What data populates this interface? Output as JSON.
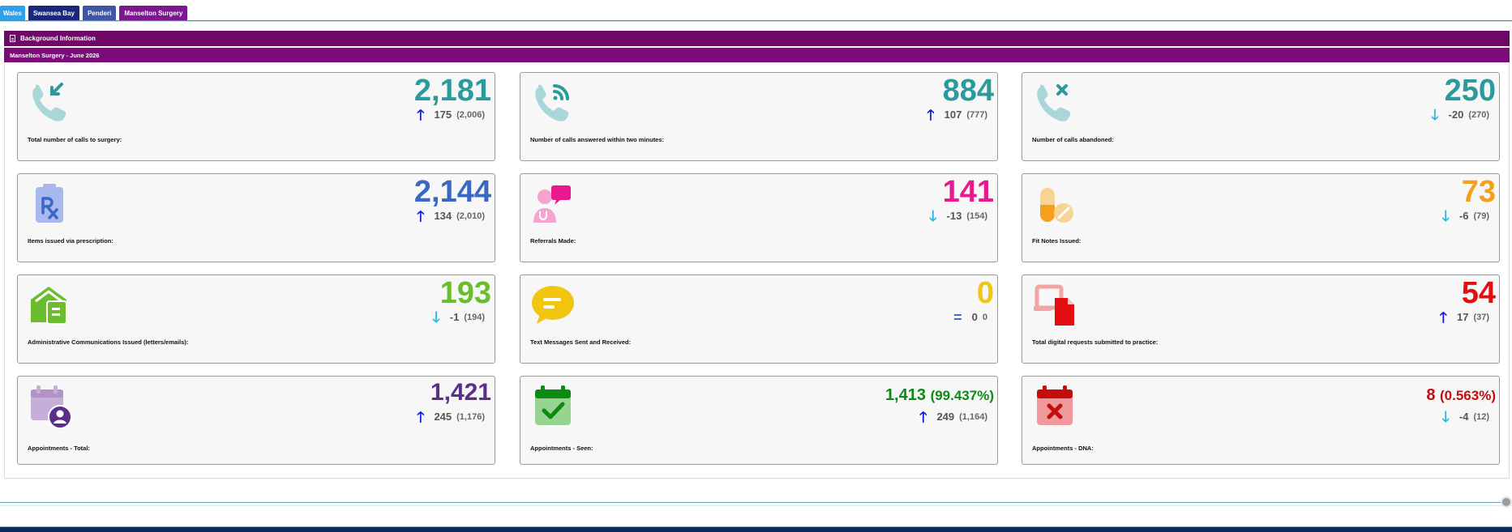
{
  "tabs": [
    {
      "label": "Wales"
    },
    {
      "label": "Swansea Bay"
    },
    {
      "label": "Penderi"
    },
    {
      "label": "Manselton Surgery"
    }
  ],
  "background_bar": {
    "label": "Background Information"
  },
  "title_bar": {
    "label": "Manselton Surgery - June 2026"
  },
  "colors": {
    "teal": "#2a9a9d",
    "blue": "#3b67c4",
    "pink": "#e8198f",
    "orange": "#f5a01a",
    "green": "#6bbd2e",
    "yellow": "#f2c511",
    "red": "#e30e12",
    "purple": "#5a2e8a",
    "dark_green": "#0c8a14",
    "dark_red": "#c60d0d"
  },
  "cards": [
    {
      "label": "Total number of calls to surgery:",
      "value": "2,181",
      "change": "175",
      "previous": "(2,006)",
      "direction": "up",
      "icon": "phone-incoming-icon"
    },
    {
      "label": "Number of calls answered within two minutes:",
      "value": "884",
      "change": "107",
      "previous": "(777)",
      "direction": "up",
      "icon": "phone-signal-icon"
    },
    {
      "label": "Number of calls abandoned:",
      "value": "250",
      "change": "-20",
      "previous": "(270)",
      "direction": "down",
      "icon": "phone-missed-icon"
    },
    {
      "label": "Items issued via prescription:",
      "value": "2,144",
      "change": "134",
      "previous": "(2,010)",
      "direction": "up",
      "icon": "prescription-icon"
    },
    {
      "label": "Referrals Made:",
      "value": "141",
      "change": "-13",
      "previous": "(154)",
      "direction": "down",
      "icon": "doctor-referral-icon"
    },
    {
      "label": "Fit Notes Issued:",
      "value": "73",
      "change": "-6",
      "previous": "(79)",
      "direction": "down",
      "icon": "pills-icon"
    },
    {
      "label": "Administrative Communications Issued (letters/emails):",
      "value": "193",
      "change": "-1",
      "previous": "(194)",
      "direction": "down",
      "icon": "mail-house-icon"
    },
    {
      "label": "Text Messages Sent and Received:",
      "value": "0",
      "change": "0",
      "previous": "0",
      "direction": "equal",
      "icon": "chat-bubble-icon"
    },
    {
      "label": "Total digital requests submitted to practice:",
      "value": "54",
      "change": "17",
      "previous": "(37)",
      "direction": "up",
      "icon": "digital-request-icon"
    },
    {
      "label": "Appointments - Total:",
      "value": "1,421",
      "change": "245",
      "previous": "(1,176)",
      "direction": "up",
      "icon": "calendar-user-icon"
    },
    {
      "label": "Appointments - Seen:",
      "value": "1,413",
      "percent": "(99.437%)",
      "change": "249",
      "previous": "(1,164)",
      "direction": "up",
      "icon": "calendar-check-icon"
    },
    {
      "label": "Appointments - DNA:",
      "value": "8",
      "percent": "(0.563%)",
      "change": "-4",
      "previous": "(12)",
      "direction": "down",
      "icon": "calendar-cross-icon"
    }
  ]
}
